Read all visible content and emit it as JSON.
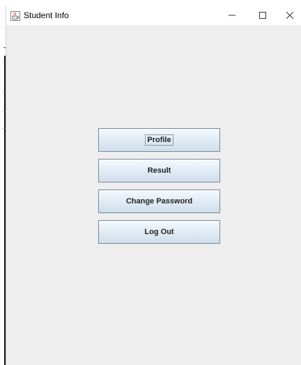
{
  "window": {
    "title": "Student Info",
    "icon": "java-coffee-cup-icon",
    "controls": {
      "minimize": "minimize-icon",
      "maximize": "maximize-icon",
      "close": "close-icon"
    }
  },
  "menu": {
    "buttons": [
      {
        "label": "Profile",
        "focused": true
      },
      {
        "label": "Result",
        "focused": false
      },
      {
        "label": "Change Password",
        "focused": false
      },
      {
        "label": "Log Out",
        "focused": false
      }
    ]
  },
  "colors": {
    "window_background": "#eeeeee",
    "titlebar_background": "#ffffff",
    "button_gradient_top": "#f6fafd",
    "button_gradient_bottom": "#cfdeeb",
    "button_border": "#7a8a99"
  }
}
